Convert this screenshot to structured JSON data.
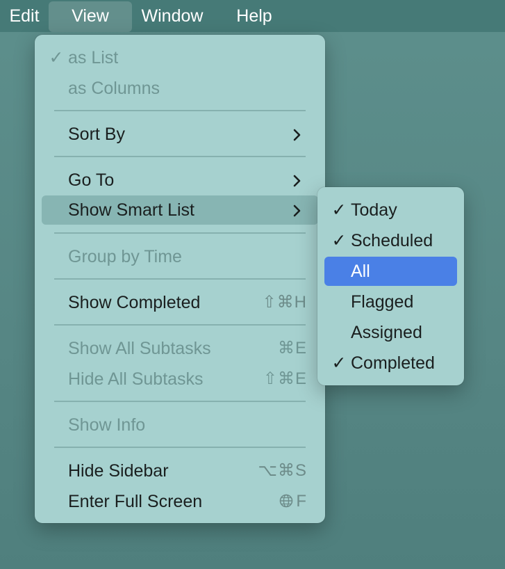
{
  "menubar": {
    "items": [
      {
        "label": "Edit"
      },
      {
        "label": "View"
      },
      {
        "label": "Window"
      },
      {
        "label": "Help"
      }
    ]
  },
  "view_menu": {
    "items": [
      {
        "label": "as List",
        "checked": true,
        "enabled": false
      },
      {
        "label": "as Columns",
        "enabled": false
      },
      {
        "label": "Sort By",
        "submenu": true
      },
      {
        "label": "Go To",
        "submenu": true
      },
      {
        "label": "Show Smart List",
        "submenu": true,
        "highlighted": true
      },
      {
        "label": "Group by Time",
        "enabled": false
      },
      {
        "label": "Show Completed",
        "shortcut": "⇧⌘H"
      },
      {
        "label": "Show All Subtasks",
        "shortcut": "⌘E",
        "enabled": false
      },
      {
        "label": "Hide All Subtasks",
        "shortcut": "⇧⌘E",
        "enabled": false
      },
      {
        "label": "Show Info",
        "enabled": false
      },
      {
        "label": "Hide Sidebar",
        "shortcut": "⌥⌘S"
      },
      {
        "label": "Enter Full Screen",
        "shortcut": "🌐F"
      }
    ]
  },
  "smart_list_submenu": {
    "items": [
      {
        "label": "Today",
        "checked": true
      },
      {
        "label": "Scheduled",
        "checked": true
      },
      {
        "label": "All",
        "selected": true
      },
      {
        "label": "Flagged"
      },
      {
        "label": "Assigned"
      },
      {
        "label": "Completed",
        "checked": true
      }
    ]
  },
  "glyphs": {
    "check": "✓",
    "shift_cmd_h": "⇧⌘H",
    "cmd_e": "⌘E",
    "shift_cmd_e": "⇧⌘E",
    "opt_cmd_s": "⌥⌘S",
    "globe_f": "F"
  },
  "colors": {
    "menubar": "#467a77",
    "menu_bg": "#a6d1cf",
    "highlight": "#87b5b3",
    "selection": "#4a80e6"
  }
}
